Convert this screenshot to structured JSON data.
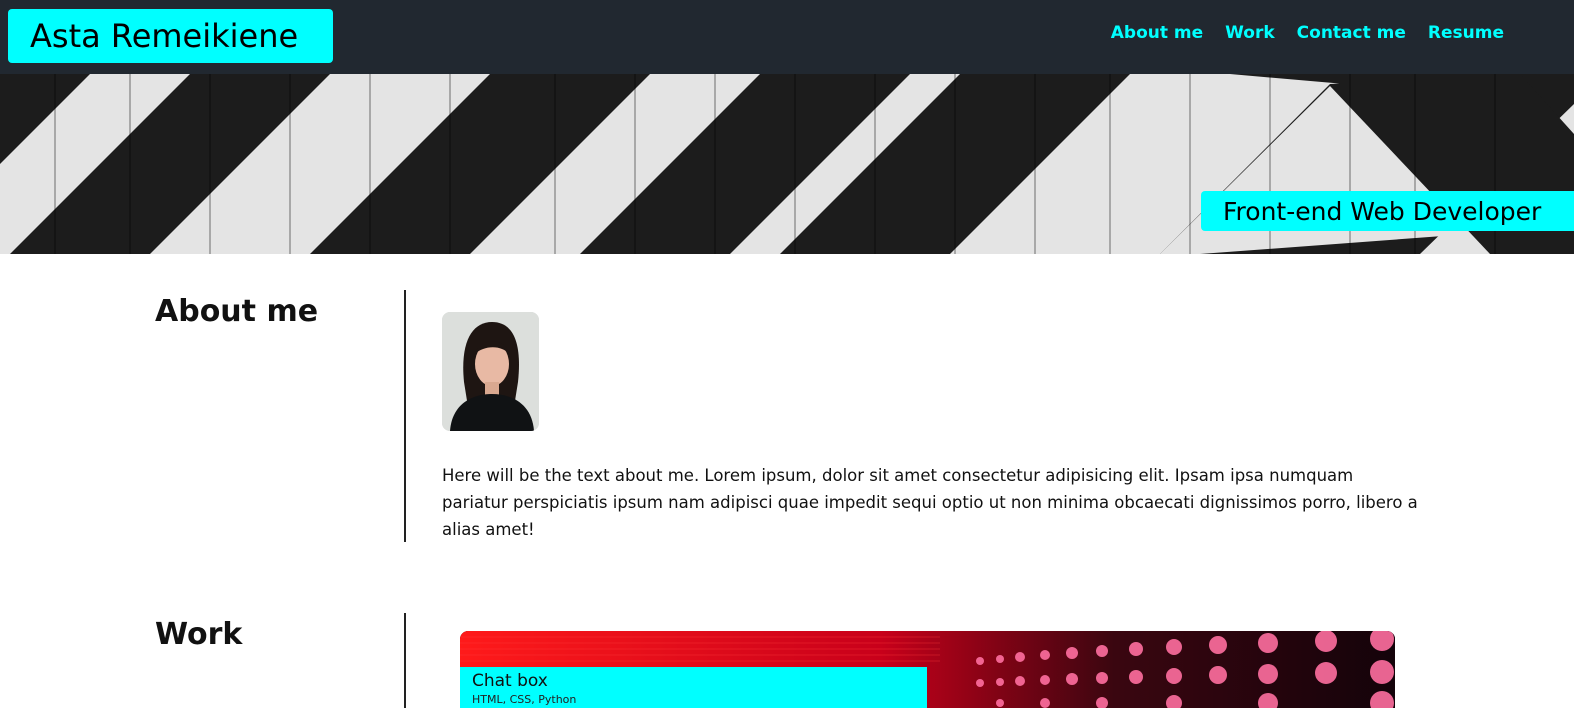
{
  "header": {
    "brand": "Asta Remeikiene",
    "nav": [
      {
        "label": "About me"
      },
      {
        "label": "Work"
      },
      {
        "label": "Contact me"
      },
      {
        "label": "Resume"
      }
    ],
    "background_color": "#212830",
    "accent_color": "#00ffff"
  },
  "hero": {
    "tagline": "Front-end Web Developer"
  },
  "about": {
    "title": "About me",
    "text": "Here will be the text about me. Lorem ipsum, dolor sit amet consectetur adipisicing elit. Ipsam ipsa numquam pariatur perspiciatis ipsum nam adipisci quae impedit sequi optio ut non minima obcaecati dignissimos porro, libero a alias amet!"
  },
  "work": {
    "title": "Work",
    "projects": [
      {
        "title": "Chat box",
        "tech": "HTML, CSS, Python"
      }
    ]
  }
}
